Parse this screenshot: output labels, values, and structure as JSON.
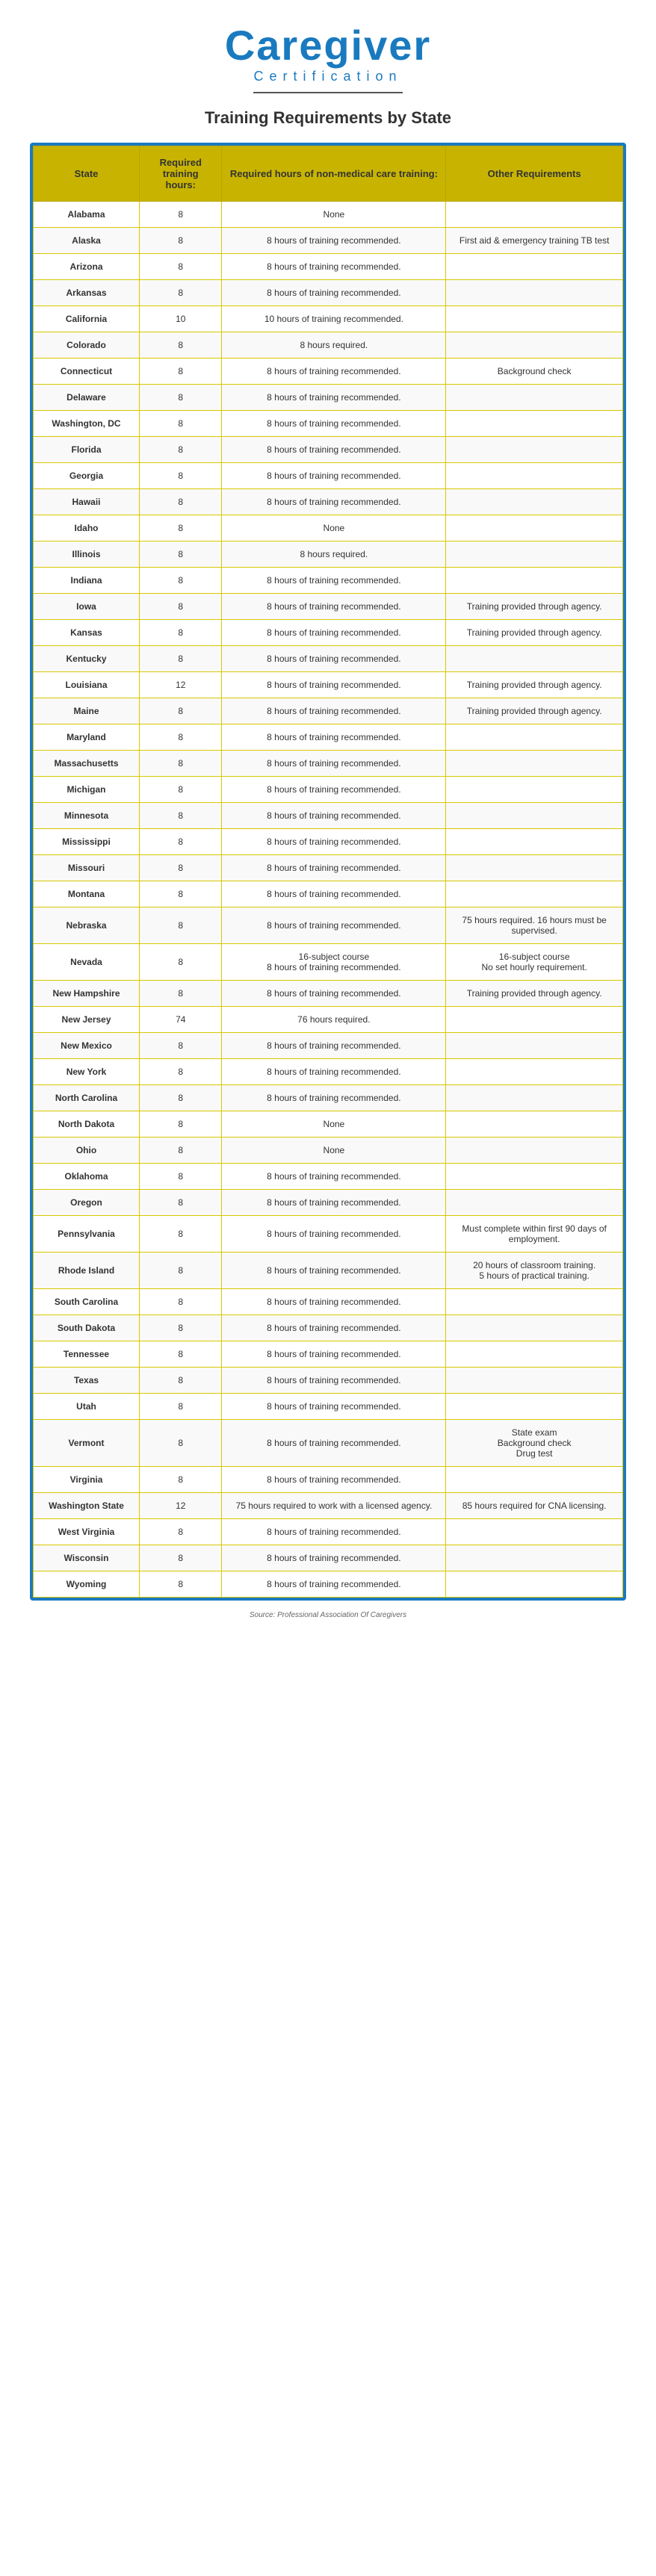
{
  "header": {
    "title": "Caregiver",
    "subtitle": "Certification",
    "divider": true,
    "section_title": "Training Requirements by State"
  },
  "table": {
    "columns": [
      "State",
      "Required training hours:",
      "Required hours of non-medical care training:",
      "Other Requirements"
    ],
    "rows": [
      [
        "Alabama",
        "8",
        "None",
        ""
      ],
      [
        "Alaska",
        "8",
        "8 hours of training recommended.",
        "First aid & emergency training TB test"
      ],
      [
        "Arizona",
        "8",
        "8 hours of training recommended.",
        ""
      ],
      [
        "Arkansas",
        "8",
        "8 hours of training recommended.",
        ""
      ],
      [
        "California",
        "10",
        "10 hours of training recommended.",
        ""
      ],
      [
        "Colorado",
        "8",
        "8 hours required.",
        ""
      ],
      [
        "Connecticut",
        "8",
        "8 hours of training recommended.",
        "Background check"
      ],
      [
        "Delaware",
        "8",
        "8 hours of training recommended.",
        ""
      ],
      [
        "Washington, DC",
        "8",
        "8 hours of training recommended.",
        ""
      ],
      [
        "Florida",
        "8",
        "8 hours of training recommended.",
        ""
      ],
      [
        "Georgia",
        "8",
        "8 hours of training recommended.",
        ""
      ],
      [
        "Hawaii",
        "8",
        "8 hours of training recommended.",
        ""
      ],
      [
        "Idaho",
        "8",
        "None",
        ""
      ],
      [
        "Illinois",
        "8",
        "8 hours required.",
        ""
      ],
      [
        "Indiana",
        "8",
        "8 hours of training recommended.",
        ""
      ],
      [
        "Iowa",
        "8",
        "8 hours of training recommended.",
        "Training provided through agency."
      ],
      [
        "Kansas",
        "8",
        "8 hours of training recommended.",
        "Training provided through agency."
      ],
      [
        "Kentucky",
        "8",
        "8 hours of training recommended.",
        ""
      ],
      [
        "Louisiana",
        "12",
        "8 hours of training recommended.",
        "Training provided through agency."
      ],
      [
        "Maine",
        "8",
        "8 hours of training recommended.",
        "Training provided through agency."
      ],
      [
        "Maryland",
        "8",
        "8 hours of training recommended.",
        ""
      ],
      [
        "Massachusetts",
        "8",
        "8 hours of training recommended.",
        ""
      ],
      [
        "Michigan",
        "8",
        "8 hours of training recommended.",
        ""
      ],
      [
        "Minnesota",
        "8",
        "8 hours of training recommended.",
        ""
      ],
      [
        "Mississippi",
        "8",
        "8 hours of training recommended.",
        ""
      ],
      [
        "Missouri",
        "8",
        "8 hours of training recommended.",
        ""
      ],
      [
        "Montana",
        "8",
        "8 hours of training recommended.",
        ""
      ],
      [
        "Nebraska",
        "8",
        "8 hours of training recommended.",
        "75 hours required. 16 hours must be supervised."
      ],
      [
        "Nevada",
        "8",
        "16-subject course\n8 hours of training recommended.",
        "16-subject course\nNo set hourly requirement."
      ],
      [
        "New Hampshire",
        "8",
        "8 hours of training recommended.",
        "Training provided through agency."
      ],
      [
        "New Jersey",
        "74",
        "76 hours required.",
        ""
      ],
      [
        "New Mexico",
        "8",
        "8 hours of training recommended.",
        ""
      ],
      [
        "New York",
        "8",
        "8 hours of training recommended.",
        ""
      ],
      [
        "North Carolina",
        "8",
        "8 hours of training recommended.",
        ""
      ],
      [
        "North Dakota",
        "8",
        "None",
        ""
      ],
      [
        "Ohio",
        "8",
        "None",
        ""
      ],
      [
        "Oklahoma",
        "8",
        "8 hours of training recommended.",
        ""
      ],
      [
        "Oregon",
        "8",
        "8 hours of training recommended.",
        ""
      ],
      [
        "Pennsylvania",
        "8",
        "8 hours of training recommended.",
        "Must complete within first 90 days of employment."
      ],
      [
        "Rhode Island",
        "8",
        "8 hours of training recommended.",
        "20 hours of classroom training.\n5 hours of practical training."
      ],
      [
        "South Carolina",
        "8",
        "8 hours of training recommended.",
        ""
      ],
      [
        "South Dakota",
        "8",
        "8 hours of training recommended.",
        ""
      ],
      [
        "Tennessee",
        "8",
        "8 hours of training recommended.",
        ""
      ],
      [
        "Texas",
        "8",
        "8 hours of training recommended.",
        ""
      ],
      [
        "Utah",
        "8",
        "8 hours of training recommended.",
        ""
      ],
      [
        "Vermont",
        "8",
        "8 hours of training recommended.",
        "State exam\nBackground check\nDrug test"
      ],
      [
        "Virginia",
        "8",
        "8 hours of training recommended.",
        ""
      ],
      [
        "Washington State",
        "12",
        "75 hours required to work with a licensed agency.",
        "85 hours required for CNA licensing."
      ],
      [
        "West Virginia",
        "8",
        "8 hours of training recommended.",
        ""
      ],
      [
        "Wisconsin",
        "8",
        "8 hours of training recommended.",
        ""
      ],
      [
        "Wyoming",
        "8",
        "8 hours of training recommended.",
        ""
      ]
    ]
  },
  "footer": {
    "source": "Source: Professional Association Of Caregivers"
  }
}
